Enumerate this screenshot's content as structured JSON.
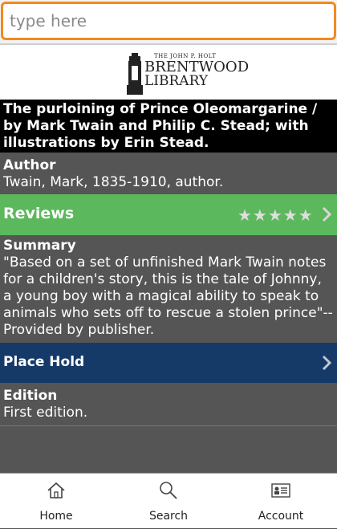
{
  "search": {
    "placeholder": "type here"
  },
  "logo": {
    "line1": "THE JOHN P. HOLT",
    "line2": "BRENTWOOD",
    "line3": "LIBRARY"
  },
  "book": {
    "title": "The purloining of Prince Oleomargarine / by Mark Twain and Philip C. Stead; with illustrations by Erin Stead."
  },
  "author": {
    "label": "Author",
    "value": "Twain, Mark, 1835-1910, author."
  },
  "reviews": {
    "label": "Reviews",
    "stars": "★★★★★",
    "rating": 0,
    "max_rating": 5,
    "star_color": "#dedede"
  },
  "summary": {
    "label": "Summary",
    "value": "\"Based on a set of unfinished Mark Twain notes for a children's story, this is the tale of Johnny, a young boy with a magical ability to speak to animals who sets off to rescue a stolen prince\"--Provided by publisher."
  },
  "hold": {
    "label": "Place Hold"
  },
  "edition": {
    "label": "Edition",
    "value": "First edition."
  },
  "tabs": [
    {
      "label": "Home",
      "icon": "home-icon"
    },
    {
      "label": "Search",
      "icon": "search-icon"
    },
    {
      "label": "Account",
      "icon": "account-card-icon"
    }
  ],
  "colors": {
    "search_border": "#f28a1d",
    "title_bg": "#000000",
    "body_bg": "#555555",
    "reviews_bg": "#5cb85c",
    "hold_bg": "#163a68"
  }
}
